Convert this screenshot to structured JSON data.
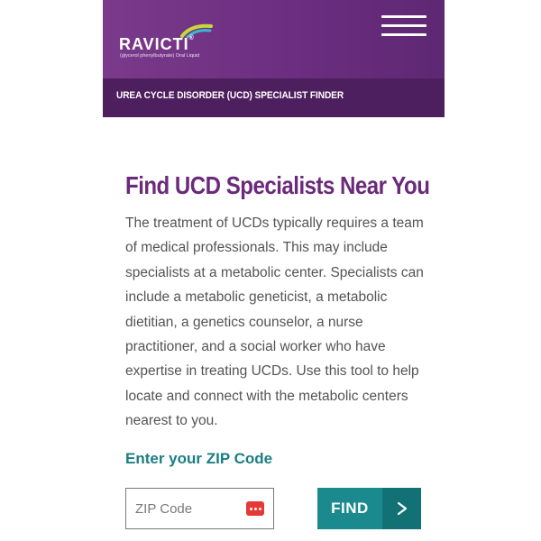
{
  "header": {
    "brand_name": "RAVICTI",
    "brand_mark": "®",
    "brand_subtitle": "(glycerol phenylbutyrate) Oral Liquid",
    "menu_icon": "hamburger-menu-icon",
    "colors": {
      "header_bg": "#7b3a8c",
      "subheader_bg": "#4e1f5e"
    }
  },
  "subheader": {
    "title": "UREA CYCLE DISORDER (UCD) SPECIALIST FINDER"
  },
  "main": {
    "title": "Find UCD Specialists Near You",
    "body": "The treatment of UCDs typically requires a team of medical professionals. This may include specialists at a metabolic center. Specialists can include a metabolic geneticist, a metabolic dietitian, a genetics counselor, a nurse practitioner, and a social worker who have expertise in treating UCDs. Use this tool to help locate and connect with the metabolic centers nearest to you.",
    "colors": {
      "title": "#6b2a7a",
      "accent": "#1a7e83"
    }
  },
  "zip_form": {
    "label": "Enter your ZIP Code",
    "placeholder": "ZIP Code",
    "value": "",
    "autofill_icon": "autofill-dots-icon",
    "find_label": "FIND",
    "find_arrow": "chevron-right-icon",
    "colors": {
      "button": "#1b8a8e",
      "button_arrow": "#127175"
    }
  }
}
